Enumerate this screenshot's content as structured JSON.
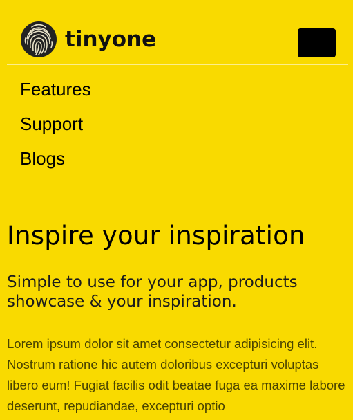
{
  "brand": {
    "name": "tinyone",
    "logo_icon": "fingerprint-icon"
  },
  "header": {
    "menu_toggle_icon": "hamburger-menu-icon"
  },
  "nav": {
    "items": [
      {
        "label": "Features"
      },
      {
        "label": "Support"
      },
      {
        "label": "Blogs"
      }
    ]
  },
  "hero": {
    "title": "Inspire your inspiration",
    "subtitle": "Simple to use for your app, products showcase & your inspiration.",
    "body": "Lorem ipsum dolor sit amet consectetur adipisicing elit. Nostrum ratione hic autem doloribus excepturi voluptas libero eum! Fugiat facilis odit beatae fuga ea maxime labore deserunt, repudiandae, excepturi optio"
  },
  "colors": {
    "background": "#F9DA00",
    "text": "#000000",
    "body_text": "#4A4400",
    "button": "#000000"
  }
}
